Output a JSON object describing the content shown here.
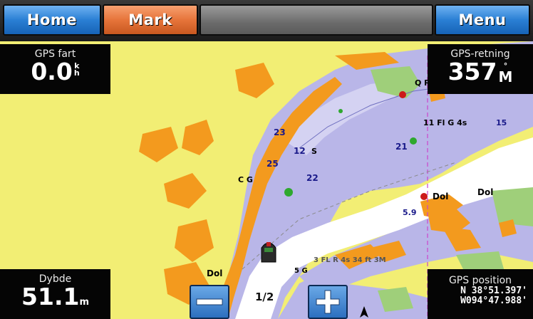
{
  "toolbar": {
    "home_label": "Home",
    "mark_label": "Mark",
    "menu_label": "Menu"
  },
  "panels": {
    "speed": {
      "label": "GPS fart",
      "value": "0.0",
      "unit_top": "k",
      "unit_bottom": "h"
    },
    "heading": {
      "label": "GPS-retning",
      "value": "357",
      "unit_top": "°",
      "unit_bottom": "M"
    },
    "depth": {
      "label": "Dybde",
      "value": "51.1",
      "unit": "m"
    },
    "position": {
      "label": "GPS position",
      "lat": "N  38°51.397'",
      "lon": "W094°47.988'"
    }
  },
  "map": {
    "scale": "1/2",
    "labels": {
      "d23": "23",
      "d12": "12",
      "s12": "S",
      "d25": "25",
      "d22": "22",
      "d21": "21",
      "cg": "C G",
      "fl": "11  Fl G 4s",
      "d15": "15",
      "qr": "Q R",
      "dol1": "Dol",
      "dol2": "Dol",
      "dol3": "Dol",
      "d59": "5.9",
      "light": "3  FL R  4s  34 ft 3M",
      "g5": "5 G"
    }
  },
  "colors": {
    "land": "#f2ee74",
    "water_shallow": "#b9b6e8",
    "water_deep": "#ffffff",
    "marsh": "#f39a1e",
    "park": "#9fcf7a",
    "button_blue": "#2a7fd4",
    "button_orange": "#e6743a"
  },
  "icons": {
    "zoom_out": "minus-icon",
    "zoom_in": "plus-icon",
    "vessel": "boat-icon",
    "north": "north-arrow-icon"
  }
}
